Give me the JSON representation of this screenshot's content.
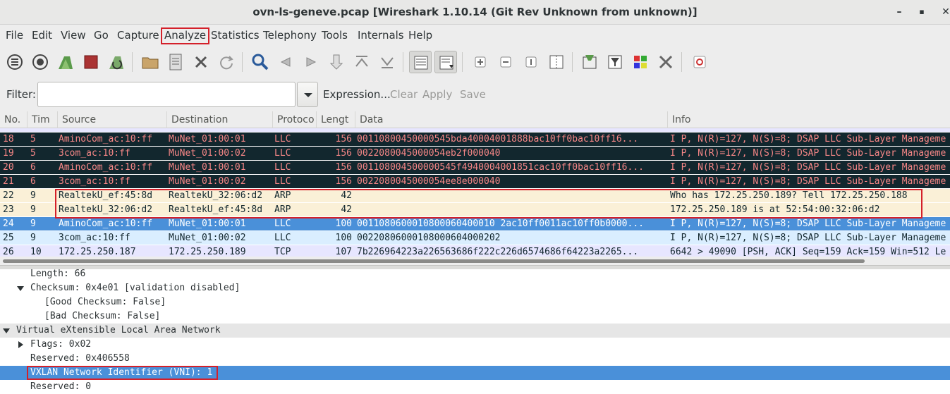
{
  "window": {
    "title": "ovn-ls-geneve.pcap   [Wireshark 1.10.14  (Git Rev Unknown from unknown)]",
    "minimize": "–",
    "maximize": "▪",
    "close": "✕"
  },
  "menu": [
    "File",
    "Edit",
    "View",
    "Go",
    "Capture",
    "Analyze",
    "Statistics",
    "Telephony",
    "Tools",
    "Internals",
    "Help"
  ],
  "filter": {
    "label": "Filter:",
    "value": "",
    "expression": "Expression...",
    "clear": "Clear",
    "apply": "Apply",
    "save": "Save"
  },
  "columns": [
    "No.",
    "Tim",
    "Source",
    "Destination",
    "Protoco",
    "Lengt",
    "Data",
    "Info"
  ],
  "packets": [
    {
      "no": "18",
      "time": "5",
      "src": "AminoCom_ac:10:ff",
      "dst": "MuNet_01:00:01",
      "proto": "LLC",
      "len": "156",
      "data": "00110800450000545bda40004001888bac10ff0bac10ff16...",
      "info": "I P, N(R)=127, N(S)=8; DSAP LLC Sub-Layer Manageme"
    },
    {
      "no": "19",
      "time": "5",
      "src": "3com_ac:10:ff",
      "dst": "MuNet_01:00:02",
      "proto": "LLC",
      "len": "156",
      "data": "0022080045000054eb2f000040",
      "info": "I P, N(R)=127, N(S)=8; DSAP LLC Sub-Layer Manageme"
    },
    {
      "no": "20",
      "time": "6",
      "src": "AminoCom_ac:10:ff",
      "dst": "MuNet_01:00:01",
      "proto": "LLC",
      "len": "156",
      "data": "001108004500000545f4940004001851cac10ff0bac10ff16...",
      "info": "I P, N(R)=127, N(S)=8; DSAP LLC Sub-Layer Manageme"
    },
    {
      "no": "21",
      "time": "6",
      "src": "3com_ac:10:ff",
      "dst": "MuNet_01:00:02",
      "proto": "LLC",
      "len": "156",
      "data": "0022080045000054ee8e000040",
      "info": "I P, N(R)=127, N(S)=8; DSAP LLC Sub-Layer Manageme"
    },
    {
      "no": "22",
      "time": "9",
      "src": "RealtekU_ef:45:8d",
      "dst": "RealtekU_32:06:d2",
      "proto": "ARP",
      "len": "42",
      "data": "",
      "info": "Who has 172.25.250.189?  Tell 172.25.250.188"
    },
    {
      "no": "23",
      "time": "9",
      "src": "RealtekU_32:06:d2",
      "dst": "RealtekU_ef:45:8d",
      "proto": "ARP",
      "len": "42",
      "data": "",
      "info": "172.25.250.189 is at 52:54:00:32:06:d2"
    },
    {
      "no": "24",
      "time": "9",
      "src": "AminoCom_ac:10:ff",
      "dst": "MuNet_01:00:01",
      "proto": "LLC",
      "len": "100",
      "data": "0011080600010800060400010 2ac10ff0011ac10ff0b0000...",
      "info": "I P, N(R)=127, N(S)=8; DSAP LLC Sub-Layer Manageme"
    },
    {
      "no": "25",
      "time": "9",
      "src": "3com_ac:10:ff",
      "dst": "MuNet_01:00:02",
      "proto": "LLC",
      "len": "100",
      "data": "00220806000108000604000202",
      "info": "I P, N(R)=127, N(S)=8; DSAP LLC Sub-Layer Manageme"
    },
    {
      "no": "26",
      "time": "10",
      "src": "172.25.250.187",
      "dst": "172.25.250.189",
      "proto": "TCP",
      "len": "107",
      "data": "7b226964223a226563686f222c226d6574686f64223a2265...",
      "info": "6642 > 49090 [PSH, ACK] Seq=159 Ack=159 Win=512 Le"
    }
  ],
  "details": {
    "length": "Length: 66",
    "checksum": "Checksum: 0x4e01 [validation disabled]",
    "good_checksum": "[Good Checksum: False]",
    "bad_checksum": "[Bad Checksum: False]",
    "vxlan": "Virtual eXtensible Local Area Network",
    "flags": "Flags: 0x02",
    "reserved1": "Reserved: 0x406558",
    "vni": "VXLAN Network Identifier (VNI): 1",
    "reserved2": "Reserved: 0"
  },
  "colors": {
    "llc_bg": "#12272e",
    "llc_fg": "#f78787",
    "arp_bg": "#faf0d7",
    "selected_bg": "#4a90d9",
    "highlight": "#d4202a"
  }
}
